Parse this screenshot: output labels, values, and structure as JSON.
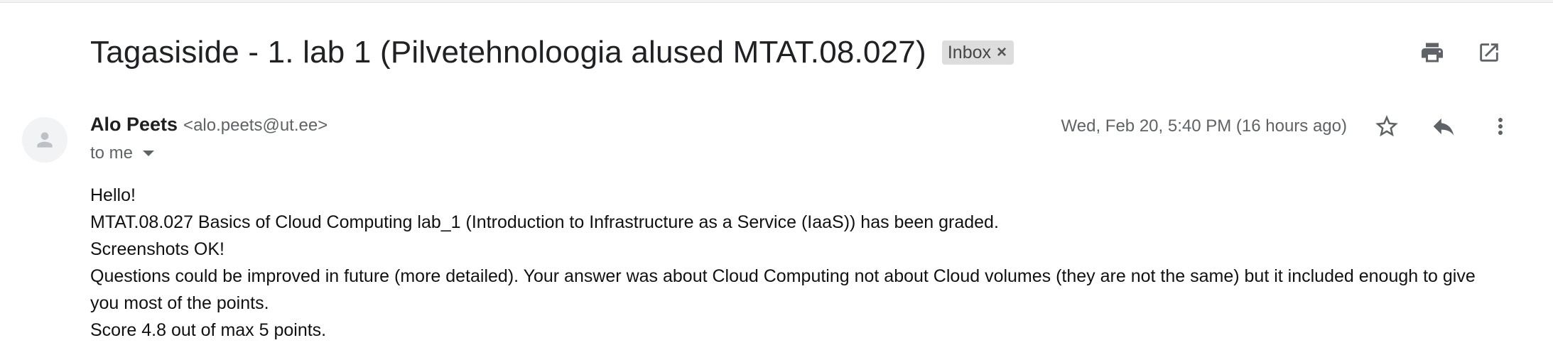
{
  "subject": "Tagasiside - 1. lab 1 (Pilvetehnoloogia alused MTAT.08.027)",
  "label": {
    "name": "Inbox",
    "remove_icon": "close-icon"
  },
  "header_actions": [
    {
      "icon": "print-icon"
    },
    {
      "icon": "open-in-new-window-icon"
    }
  ],
  "sender": {
    "name": "Alo Peets",
    "email": "<alo.peets@ut.ee>",
    "avatar_icon": "person-icon"
  },
  "recipient": {
    "text": "to me",
    "expand_icon": "caret-down-icon"
  },
  "date": "Wed, Feb 20, 5:40 PM (16 hours ago)",
  "message_actions": [
    {
      "icon": "star-icon"
    },
    {
      "icon": "reply-icon"
    },
    {
      "icon": "more-vert-icon"
    }
  ],
  "body_lines": [
    "Hello!",
    "MTAT.08.027 Basics of Cloud Computing lab_1 (Introduction to Infrastructure as a Service (IaaS)) has been graded.",
    "Screenshots OK!",
    "Questions could be improved in future (more detailed). Your answer was about Cloud Computing not about Cloud volumes (they are not the same) but it included enough to give you most of the points.",
    "Score 4.8 out of max 5 points."
  ],
  "colors": {
    "chip_background": "#dddddd",
    "icon": "#5f6368",
    "text": "#202124"
  }
}
